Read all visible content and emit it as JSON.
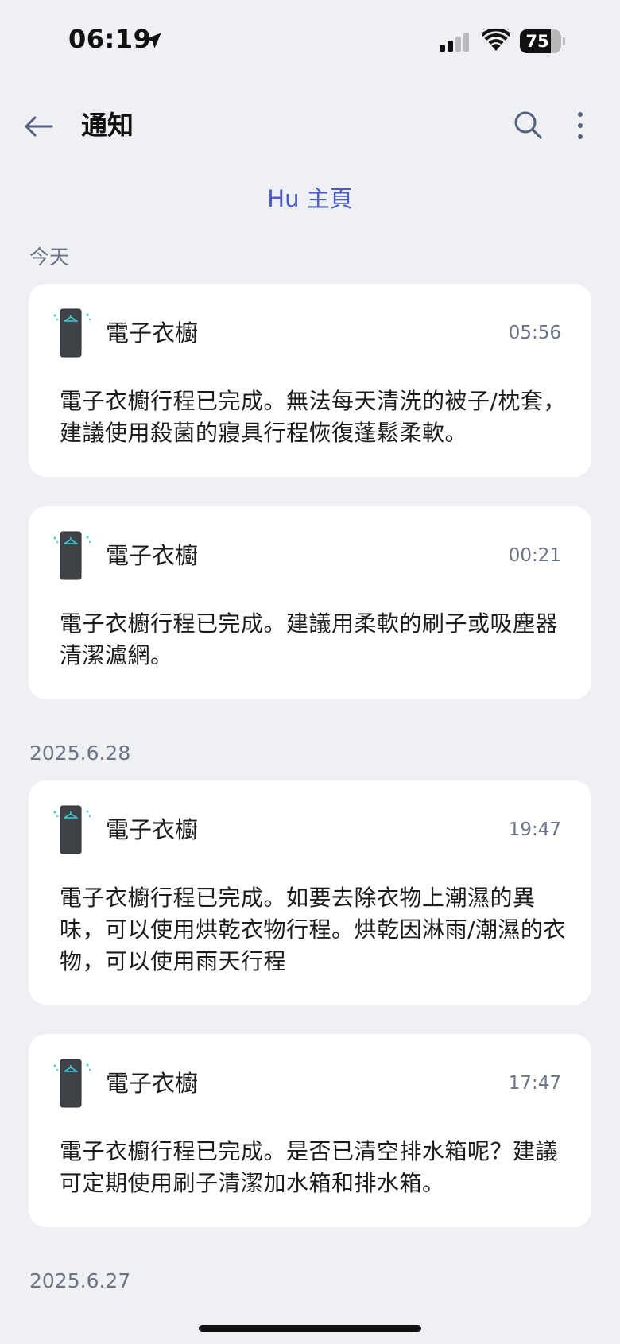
{
  "status_bar": {
    "time": "06:19",
    "battery_level": 75,
    "battery_text": "75",
    "icons": [
      "location-arrow-icon",
      "cellular-signal-icon",
      "wifi-icon",
      "battery-icon"
    ]
  },
  "header": {
    "title": "通知",
    "back_icon": "arrow-left-icon",
    "search_icon": "search-icon",
    "more_icon": "more-vertical-icon"
  },
  "home_link": "Hu 主頁",
  "sections": [
    {
      "label": "今天",
      "notifications": [
        {
          "device": "電子衣櫥",
          "time": "05:56",
          "message": "電子衣櫥行程已完成。無法每天清洗的被子/枕套，建議使用殺菌的寢具行程恢復蓬鬆柔軟。"
        },
        {
          "device": "電子衣櫥",
          "time": "00:21",
          "message": "電子衣櫥行程已完成。建議用柔軟的刷子或吸塵器清潔濾網。"
        }
      ]
    },
    {
      "label": "2025.6.28",
      "notifications": [
        {
          "device": "電子衣櫥",
          "time": "19:47",
          "message": "電子衣櫥行程已完成。如要去除衣物上潮濕的異味，可以使用烘乾衣物行程。烘乾因淋雨/潮濕的衣物，可以使用雨天行程"
        },
        {
          "device": "電子衣櫥",
          "time": "17:47",
          "message": "電子衣櫥行程已完成。是否已清空排水箱呢？建議可定期使用刷子清潔加水箱和排水箱。"
        }
      ]
    },
    {
      "label": "2025.6.27",
      "notifications": []
    }
  ],
  "colors": {
    "background": "#eff0f4",
    "card": "#ffffff",
    "accent": "#4a5bc6",
    "secondary_text": "#6b7385",
    "device_accent": "#3fd0d6"
  }
}
